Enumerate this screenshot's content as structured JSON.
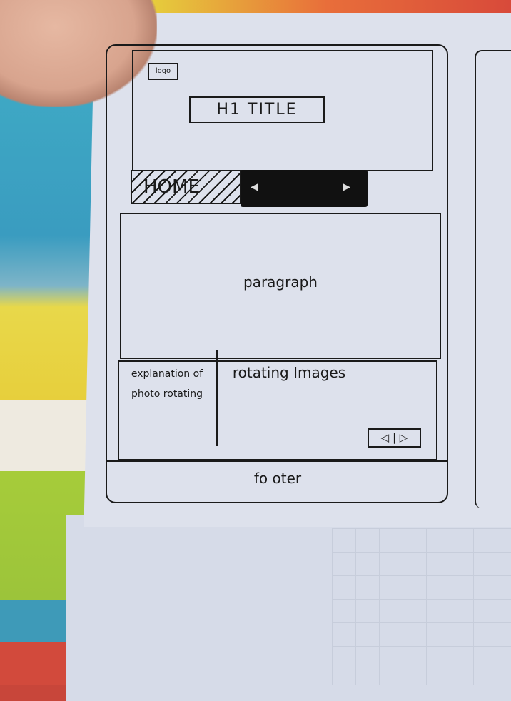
{
  "sketch": {
    "logo": "logo",
    "title": "H1 TITLE",
    "nav": {
      "home": "HOME",
      "prev_icon": "triangle-left-icon",
      "next_icon": "triangle-right-icon"
    },
    "main": {
      "paragraph": "paragraph"
    },
    "slideshow": {
      "explanation": "explanation of photo rotating",
      "images": "rotating Images",
      "controls": {
        "prev": "◁",
        "next": "▷"
      }
    },
    "footer": "fo oter"
  },
  "colors": {
    "paper": "#dde1ec",
    "ink": "#1a1a1a"
  }
}
